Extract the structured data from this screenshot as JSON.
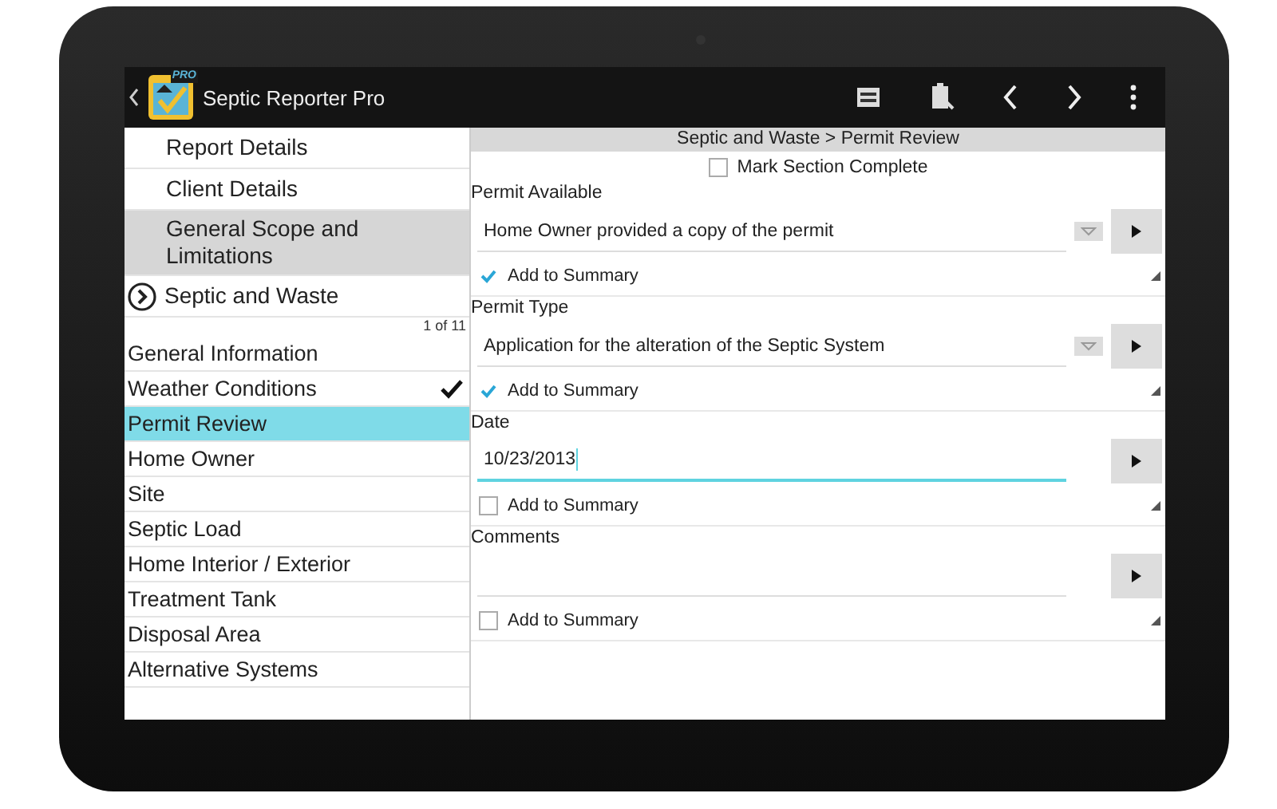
{
  "action_bar": {
    "title": "Septic Reporter Pro",
    "logo_badge": "PRO"
  },
  "sidebar": {
    "sections": [
      {
        "label": "Report Details",
        "selected": false,
        "expandable": false
      },
      {
        "label": "Client Details",
        "selected": false,
        "expandable": false
      },
      {
        "label": "General Scope and Limitations",
        "selected": true,
        "expandable": false
      },
      {
        "label": "Septic and Waste",
        "selected": false,
        "expandable": true
      }
    ],
    "counter": "1 of 11",
    "items": [
      {
        "label": "General Information",
        "selected": false,
        "done": false
      },
      {
        "label": "Weather Conditions",
        "selected": false,
        "done": true
      },
      {
        "label": "Permit Review",
        "selected": true,
        "done": false
      },
      {
        "label": "Home Owner",
        "selected": false,
        "done": false
      },
      {
        "label": "Site",
        "selected": false,
        "done": false
      },
      {
        "label": "Septic Load",
        "selected": false,
        "done": false
      },
      {
        "label": "Home Interior / Exterior",
        "selected": false,
        "done": false
      },
      {
        "label": "Treatment Tank",
        "selected": false,
        "done": false
      },
      {
        "label": "Disposal Area",
        "selected": false,
        "done": false
      },
      {
        "label": "Alternative Systems",
        "selected": false,
        "done": false
      }
    ]
  },
  "content": {
    "breadcrumb": "Septic and Waste > Permit Review",
    "mark_complete": {
      "label": "Mark Section Complete",
      "checked": false
    },
    "fields": [
      {
        "label": "Permit Available",
        "kind": "dropdown",
        "value": "Home Owner provided a copy of the permit",
        "focused": false,
        "summary": {
          "label": "Add to Summary",
          "checked": true
        }
      },
      {
        "label": "Permit Type",
        "kind": "dropdown",
        "value": "Application for the alteration of the Septic System",
        "focused": false,
        "summary": {
          "label": "Add to Summary",
          "checked": true
        }
      },
      {
        "label": "Date",
        "kind": "text",
        "value": "10/23/2013",
        "focused": true,
        "summary": {
          "label": "Add to Summary",
          "checked": false
        }
      },
      {
        "label": "Comments",
        "kind": "text",
        "focused": false,
        "summary": {
          "label": "Add to Summary",
          "checked": false
        }
      }
    ]
  }
}
